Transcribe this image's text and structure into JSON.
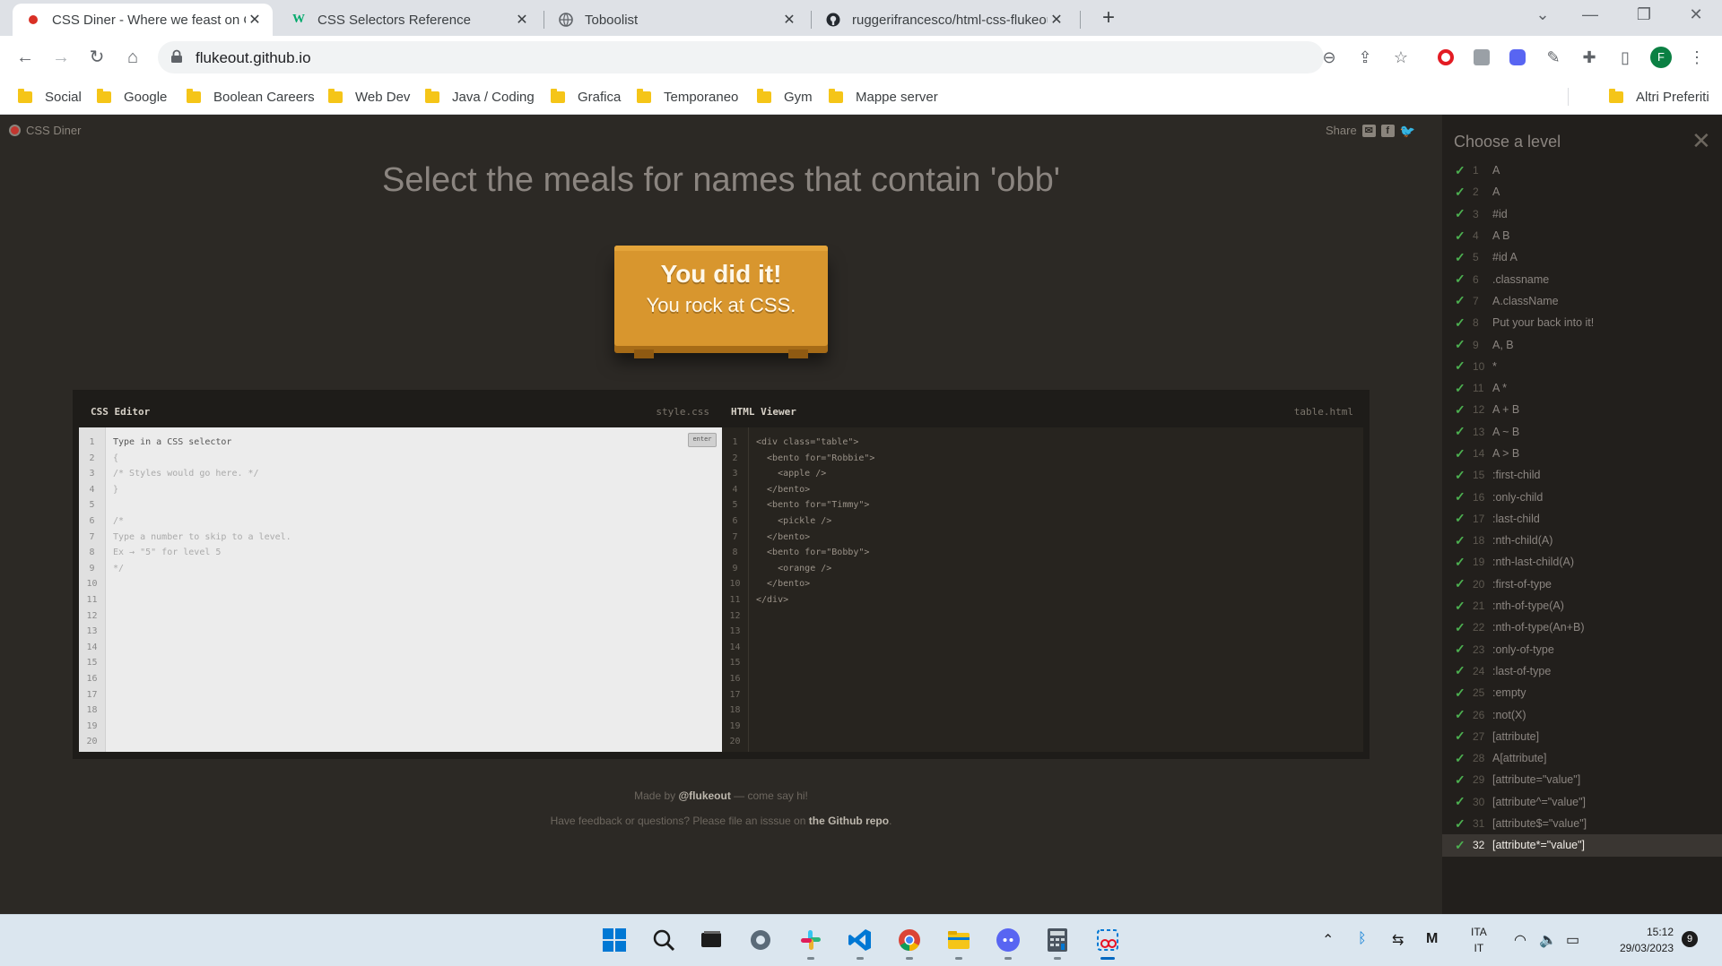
{
  "browser": {
    "tabs": [
      {
        "title": "CSS Diner - Where we feast on CSS",
        "icon": "css-diner-favicon",
        "active": true
      },
      {
        "title": "CSS Selectors Reference",
        "icon": "w3schools-favicon",
        "active": false
      },
      {
        "title": "Toboolist",
        "icon": "globe-icon",
        "active": false
      },
      {
        "title": "ruggerifrancesco/html-css-flukeout",
        "icon": "github-icon",
        "active": false
      }
    ],
    "url": "flukeout.github.io",
    "profile_initial": "F",
    "bookmarks": [
      "Social",
      "Google",
      "Boolean Careers",
      "Web Dev",
      "Java / Coding",
      "Grafica",
      "Temporaneo",
      "Gym",
      "Mappe server"
    ],
    "other_bookmarks": "Altri Preferiti"
  },
  "page": {
    "logo": "CSS Diner",
    "share": "Share",
    "instruction": "Select the meals for names that contain 'obb'",
    "done_line1": "You did it!",
    "done_line2": "You rock at CSS.",
    "css_editor": {
      "title": "CSS Editor",
      "file": "style.css",
      "enter": "enter",
      "lines": [
        {
          "t": "Type in a CSS selector",
          "k": "l"
        },
        {
          "t": "{",
          "k": "c"
        },
        {
          "t": "/* Styles would go here. */",
          "k": "c"
        },
        {
          "t": "}",
          "k": "c"
        },
        {
          "t": "",
          "k": "c"
        },
        {
          "t": "/*",
          "k": "c"
        },
        {
          "t": "Type a number to skip to a level.",
          "k": "c"
        },
        {
          "t": "Ex → \"5\" for level 5",
          "k": "c"
        },
        {
          "t": "*/",
          "k": "c"
        }
      ]
    },
    "html_viewer": {
      "title": "HTML Viewer",
      "file": "table.html",
      "lines": [
        "<div class=\"table\">",
        "  <bento for=\"Robbie\">",
        "    <apple />",
        "  </bento>",
        "  <bento for=\"Timmy\">",
        "    <pickle />",
        "  </bento>",
        "  <bento for=\"Bobby\">",
        "    <orange />",
        "  </bento>",
        "</div>"
      ]
    },
    "line_count": 20,
    "footer": {
      "made_by_prefix": "Made by ",
      "made_by_link": "@flukeout",
      "made_by_suffix": " — come say hi!",
      "feedback_prefix": "Have feedback or questions? Please file an isssue on ",
      "feedback_link": "the Github repo",
      "feedback_suffix": "."
    },
    "sidebar": {
      "title": "Choose a level",
      "levels": [
        "A",
        "A",
        "#id",
        "A B",
        "#id A",
        ".classname",
        "A.className",
        "Put your back into it!",
        "A, B",
        "*",
        "A *",
        "A + B",
        "A ~ B",
        "A > B",
        ":first-child",
        ":only-child",
        ":last-child",
        ":nth-child(A)",
        ":nth-last-child(A)",
        ":first-of-type",
        ":nth-of-type(A)",
        ":nth-of-type(An+B)",
        ":only-of-type",
        ":last-of-type",
        ":empty",
        ":not(X)",
        "[attribute]",
        "A[attribute]",
        "[attribute=\"value\"]",
        "[attribute^=\"value\"]",
        "[attribute$=\"value\"]",
        "[attribute*=\"value\"]"
      ],
      "current_level": 32
    }
  },
  "taskbar": {
    "apps": [
      "windows-start-icon",
      "search-icon",
      "task-view-icon",
      "settings-icon",
      "slack-icon",
      "vscode-icon",
      "chrome-icon",
      "file-explorer-icon",
      "discord-icon",
      "calculator-icon",
      "snipping-tool-icon"
    ],
    "language": "ITA",
    "language_sub": "IT",
    "time": "15:12",
    "date": "29/03/2023",
    "notifications": "9"
  },
  "colors": {
    "diner_bg": "#2c2925",
    "sidebar_bg": "#221f1c",
    "table_orange": "#d8962e",
    "check_green": "#4caf50"
  }
}
